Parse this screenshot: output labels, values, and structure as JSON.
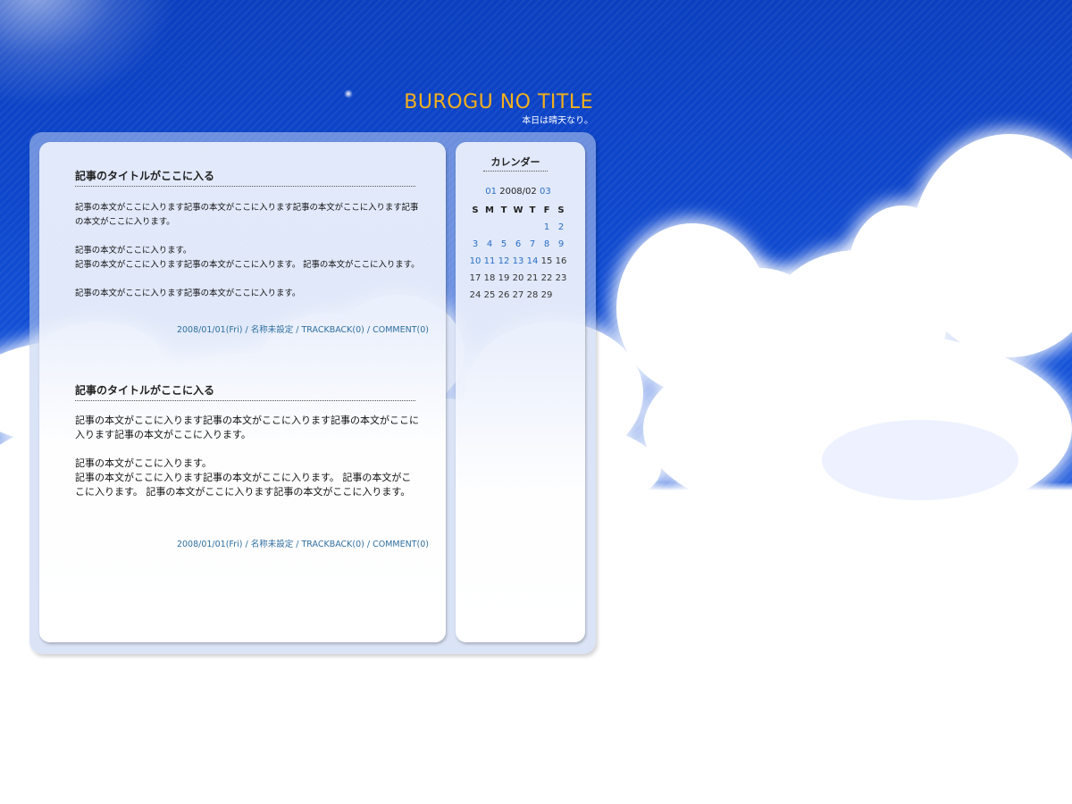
{
  "header": {
    "title": "BUROGU NO TITLE",
    "subtitle": "本日は晴天なり。"
  },
  "articles": [
    {
      "title": "記事のタイトルがここに入る",
      "paragraphs": [
        "記事の本文がここに入ります記事の本文がここに入ります記事の本文がここに入ります記事の本文がここに入ります。",
        "記事の本文がここに入ります。\n記事の本文がここに入ります記事の本文がここに入ります。 記事の本文がここに入ります。",
        "記事の本文がここに入ります記事の本文がここに入ります。"
      ],
      "meta": {
        "date": "2008/01/01(Fri)",
        "author": "名称未設定",
        "trackback": "TRACKBACK(0)",
        "comment": "COMMENT(0)",
        "separator": " / "
      }
    },
    {
      "title": "記事のタイトルがここに入る",
      "paragraphs": [
        "記事の本文がここに入ります記事の本文がここに入ります記事の本文がここに入ります記事の本文がここに入ります。",
        "記事の本文がここに入ります。\n記事の本文がここに入ります記事の本文がここに入ります。 記事の本文がここに入ります。 記事の本文がここに入ります記事の本文がここに入ります。"
      ],
      "meta": {
        "date": "2008/01/01(Fri)",
        "author": "名称未設定",
        "trackback": "TRACKBACK(0)",
        "comment": "COMMENT(0)",
        "separator": " / "
      }
    }
  ],
  "calendar": {
    "heading": "カレンダー",
    "prev": "01",
    "current": "2008/02",
    "next": "03",
    "weekdays": [
      "S",
      "M",
      "T",
      "W",
      "T",
      "F",
      "S"
    ],
    "days": [
      "",
      "",
      "",
      "",
      "",
      "1",
      "2",
      "3",
      "4",
      "5",
      "6",
      "7",
      "8",
      "9",
      "10",
      "11",
      "12",
      "13",
      "14",
      "15",
      "16",
      "17",
      "18",
      "19",
      "20",
      "21",
      "22",
      "23",
      "24",
      "25",
      "26",
      "27",
      "28",
      "29",
      ""
    ],
    "linked_days": [
      "1",
      "2",
      "3",
      "4",
      "5",
      "6",
      "7",
      "8",
      "9",
      "10",
      "11",
      "12",
      "13",
      "14"
    ]
  },
  "colors": {
    "sky": "#0e47cc",
    "title": "#f4b01c",
    "link": "#2f6f9f",
    "calendar_link": "#2a6fc4"
  }
}
